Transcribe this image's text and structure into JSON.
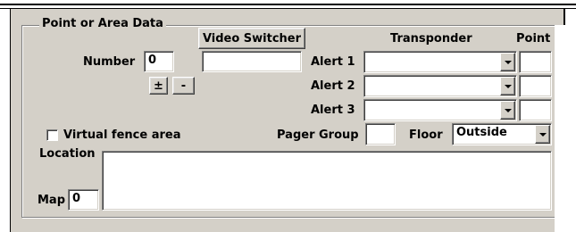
{
  "group": {
    "title": "Point or Area Data"
  },
  "video_switcher": {
    "label": "Video Switcher",
    "value": ""
  },
  "columns": {
    "transponder": "Transponder",
    "point": "Point"
  },
  "number": {
    "label": "Number",
    "value": "0"
  },
  "stepper": {
    "plus": "±",
    "minus": "-"
  },
  "alerts": [
    {
      "label": "Alert 1",
      "transponder": "",
      "point": ""
    },
    {
      "label": "Alert 2",
      "transponder": "",
      "point": ""
    },
    {
      "label": "Alert 3",
      "transponder": "",
      "point": ""
    }
  ],
  "virtual_fence": {
    "label": "Virtual fence area",
    "checked": false
  },
  "pager_group": {
    "label": "Pager Group",
    "value": ""
  },
  "floor": {
    "label": "Floor",
    "value": "Outside"
  },
  "location": {
    "label": "Location",
    "value": ""
  },
  "map": {
    "label": "Map",
    "value": "0"
  }
}
